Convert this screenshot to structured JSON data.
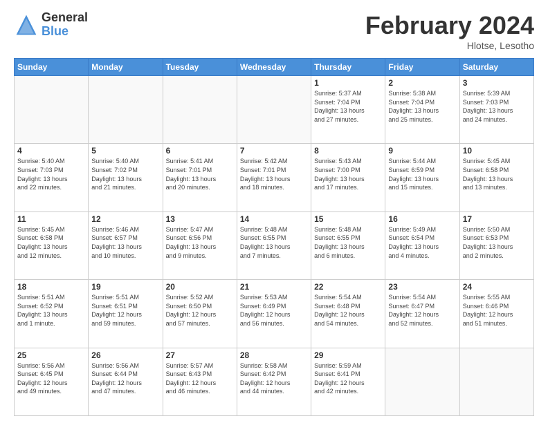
{
  "header": {
    "logo_general": "General",
    "logo_blue": "Blue",
    "title": "February 2024",
    "location": "Hlotse, Lesotho"
  },
  "days_of_week": [
    "Sunday",
    "Monday",
    "Tuesday",
    "Wednesday",
    "Thursday",
    "Friday",
    "Saturday"
  ],
  "weeks": [
    [
      {
        "day": "",
        "info": ""
      },
      {
        "day": "",
        "info": ""
      },
      {
        "day": "",
        "info": ""
      },
      {
        "day": "",
        "info": ""
      },
      {
        "day": "1",
        "info": "Sunrise: 5:37 AM\nSunset: 7:04 PM\nDaylight: 13 hours\nand 27 minutes."
      },
      {
        "day": "2",
        "info": "Sunrise: 5:38 AM\nSunset: 7:04 PM\nDaylight: 13 hours\nand 25 minutes."
      },
      {
        "day": "3",
        "info": "Sunrise: 5:39 AM\nSunset: 7:03 PM\nDaylight: 13 hours\nand 24 minutes."
      }
    ],
    [
      {
        "day": "4",
        "info": "Sunrise: 5:40 AM\nSunset: 7:03 PM\nDaylight: 13 hours\nand 22 minutes."
      },
      {
        "day": "5",
        "info": "Sunrise: 5:40 AM\nSunset: 7:02 PM\nDaylight: 13 hours\nand 21 minutes."
      },
      {
        "day": "6",
        "info": "Sunrise: 5:41 AM\nSunset: 7:01 PM\nDaylight: 13 hours\nand 20 minutes."
      },
      {
        "day": "7",
        "info": "Sunrise: 5:42 AM\nSunset: 7:01 PM\nDaylight: 13 hours\nand 18 minutes."
      },
      {
        "day": "8",
        "info": "Sunrise: 5:43 AM\nSunset: 7:00 PM\nDaylight: 13 hours\nand 17 minutes."
      },
      {
        "day": "9",
        "info": "Sunrise: 5:44 AM\nSunset: 6:59 PM\nDaylight: 13 hours\nand 15 minutes."
      },
      {
        "day": "10",
        "info": "Sunrise: 5:45 AM\nSunset: 6:58 PM\nDaylight: 13 hours\nand 13 minutes."
      }
    ],
    [
      {
        "day": "11",
        "info": "Sunrise: 5:45 AM\nSunset: 6:58 PM\nDaylight: 13 hours\nand 12 minutes."
      },
      {
        "day": "12",
        "info": "Sunrise: 5:46 AM\nSunset: 6:57 PM\nDaylight: 13 hours\nand 10 minutes."
      },
      {
        "day": "13",
        "info": "Sunrise: 5:47 AM\nSunset: 6:56 PM\nDaylight: 13 hours\nand 9 minutes."
      },
      {
        "day": "14",
        "info": "Sunrise: 5:48 AM\nSunset: 6:55 PM\nDaylight: 13 hours\nand 7 minutes."
      },
      {
        "day": "15",
        "info": "Sunrise: 5:48 AM\nSunset: 6:55 PM\nDaylight: 13 hours\nand 6 minutes."
      },
      {
        "day": "16",
        "info": "Sunrise: 5:49 AM\nSunset: 6:54 PM\nDaylight: 13 hours\nand 4 minutes."
      },
      {
        "day": "17",
        "info": "Sunrise: 5:50 AM\nSunset: 6:53 PM\nDaylight: 13 hours\nand 2 minutes."
      }
    ],
    [
      {
        "day": "18",
        "info": "Sunrise: 5:51 AM\nSunset: 6:52 PM\nDaylight: 13 hours\nand 1 minute."
      },
      {
        "day": "19",
        "info": "Sunrise: 5:51 AM\nSunset: 6:51 PM\nDaylight: 12 hours\nand 59 minutes."
      },
      {
        "day": "20",
        "info": "Sunrise: 5:52 AM\nSunset: 6:50 PM\nDaylight: 12 hours\nand 57 minutes."
      },
      {
        "day": "21",
        "info": "Sunrise: 5:53 AM\nSunset: 6:49 PM\nDaylight: 12 hours\nand 56 minutes."
      },
      {
        "day": "22",
        "info": "Sunrise: 5:54 AM\nSunset: 6:48 PM\nDaylight: 12 hours\nand 54 minutes."
      },
      {
        "day": "23",
        "info": "Sunrise: 5:54 AM\nSunset: 6:47 PM\nDaylight: 12 hours\nand 52 minutes."
      },
      {
        "day": "24",
        "info": "Sunrise: 5:55 AM\nSunset: 6:46 PM\nDaylight: 12 hours\nand 51 minutes."
      }
    ],
    [
      {
        "day": "25",
        "info": "Sunrise: 5:56 AM\nSunset: 6:45 PM\nDaylight: 12 hours\nand 49 minutes."
      },
      {
        "day": "26",
        "info": "Sunrise: 5:56 AM\nSunset: 6:44 PM\nDaylight: 12 hours\nand 47 minutes."
      },
      {
        "day": "27",
        "info": "Sunrise: 5:57 AM\nSunset: 6:43 PM\nDaylight: 12 hours\nand 46 minutes."
      },
      {
        "day": "28",
        "info": "Sunrise: 5:58 AM\nSunset: 6:42 PM\nDaylight: 12 hours\nand 44 minutes."
      },
      {
        "day": "29",
        "info": "Sunrise: 5:59 AM\nSunset: 6:41 PM\nDaylight: 12 hours\nand 42 minutes."
      },
      {
        "day": "",
        "info": ""
      },
      {
        "day": "",
        "info": ""
      }
    ]
  ]
}
